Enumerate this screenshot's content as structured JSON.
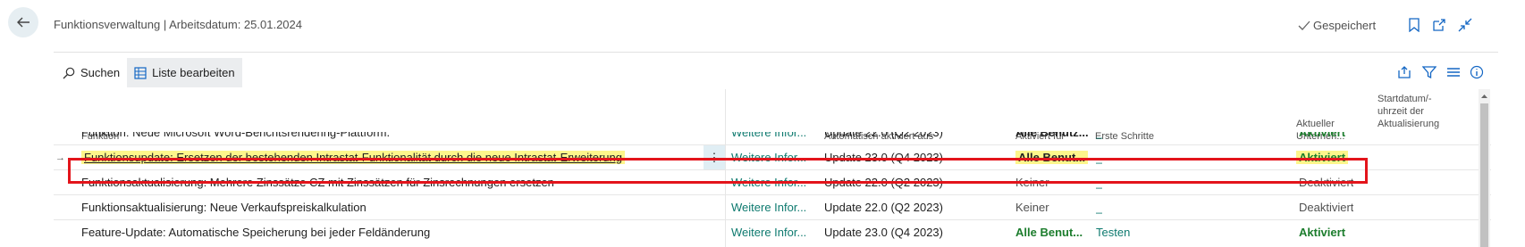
{
  "header": {
    "title": "Funktionsverwaltung | Arbeitsdatum: 25.01.2024",
    "saved_status": "Gespeichert"
  },
  "actions": {
    "search": "Suchen",
    "edit_list": "Liste bearbeiten"
  },
  "columns": {
    "funktion": "Funktion",
    "automatisch": "Automatisch aktiviert aus",
    "aktiviert_fuer": "Aktiviert für",
    "erste_schritte": "Erste Schritte",
    "aktueller_1": "Aktueller",
    "aktueller_2": "Unterneh...",
    "start_1": "Startdatum/-",
    "start_2": "uhrzeit der",
    "start_3": "Aktualisierung"
  },
  "rows": [
    {
      "name": "Funktion: Neue Microsoft Word-Berichtsrendering-Plattform.",
      "more": "Weitere Infor...",
      "auto": "Update 22.0 (Q2 2023)",
      "enabled_for": "Alle Benutz...",
      "first_steps": "_",
      "status": "Aktiviert"
    },
    {
      "name": "Funktionsupdate: Ersetzen der bestehenden Intrastat-Funktionalität durch die neue Intrastat-Erweiterung",
      "more": "Weitere Infor...",
      "auto": "Update 23.0 (Q4 2023)",
      "enabled_for": "Alle Benut...",
      "first_steps": "_",
      "status": "Aktiviert",
      "dots": "⋮",
      "arrow": "→"
    },
    {
      "name": "Funktionsaktualisierung: Mehrere Zinssätze CZ mit Zinssätzen für Zinsrechnungen ersetzen",
      "more": "Weitere Infor...",
      "auto": "Update 22.0 (Q2 2023)",
      "enabled_for": "Keiner",
      "first_steps": "_",
      "status": "Deaktiviert"
    },
    {
      "name": "Funktionsaktualisierung: Neue Verkaufspreiskalkulation",
      "more": "Weitere Infor...",
      "auto": "Update 22.0 (Q2 2023)",
      "enabled_for": "Keiner",
      "first_steps": "_",
      "status": "Deaktiviert"
    },
    {
      "name": "Feature-Update: Automatische Speicherung bei jeder Feldänderung",
      "more": "Weitere Infor...",
      "auto": "Update 23.0 (Q4 2023)",
      "enabled_for": "Alle Benut...",
      "first_steps": "Testen",
      "status": "Aktiviert"
    }
  ],
  "colors": {
    "link": "#0e7a6f",
    "highlight": "#fdf68b",
    "selection_border": "#e3141b",
    "active_green": "#1c7d2d"
  },
  "icons": [
    "back-arrow-icon",
    "checkmark-icon",
    "bookmark-icon",
    "open-new-window-icon",
    "collapse-icon",
    "search-icon",
    "edit-list-icon",
    "share-icon",
    "filter-icon",
    "list-icon",
    "info-icon"
  ]
}
